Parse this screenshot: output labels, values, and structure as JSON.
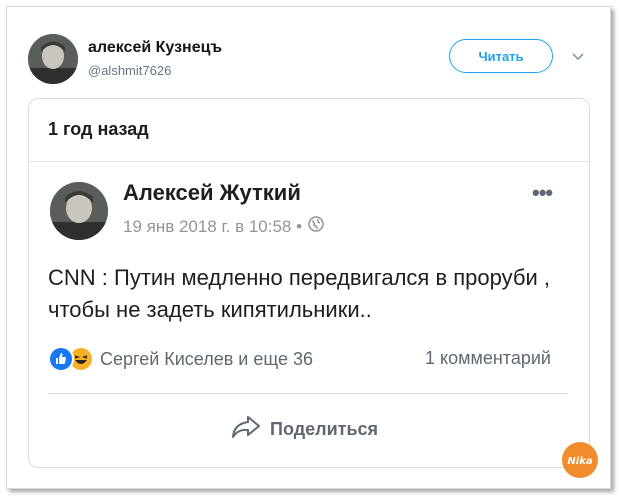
{
  "tweet": {
    "author_name": "алексей Кузнецъ",
    "author_handle": "@alshmit7626",
    "follow_label": "Читать"
  },
  "fb_post": {
    "time_ago": "1 год назад",
    "author_name": "Алексей Жуткий",
    "date": "19 янв 2018 г. в 10:58 •",
    "text": "CNN : Путин медленно передвигался в проруби , чтобы не задеть кипятильники..",
    "reactions_text": "Сергей Киселев и еще 36",
    "comments_text": "1 комментарий",
    "share_label": "Поделиться",
    "more_label": "•••"
  },
  "icons": {
    "caret": "chevron-down-icon",
    "globe": "globe-icon",
    "like": "like-reaction-icon",
    "haha": "haha-reaction-icon",
    "share": "share-arrow-icon",
    "watermark": "logo-icon"
  },
  "colors": {
    "twitter_blue": "#1da1f2",
    "fb_blue": "#1877f2",
    "haha_yellow": "#f7b125",
    "meta_gray": "#90949c"
  }
}
